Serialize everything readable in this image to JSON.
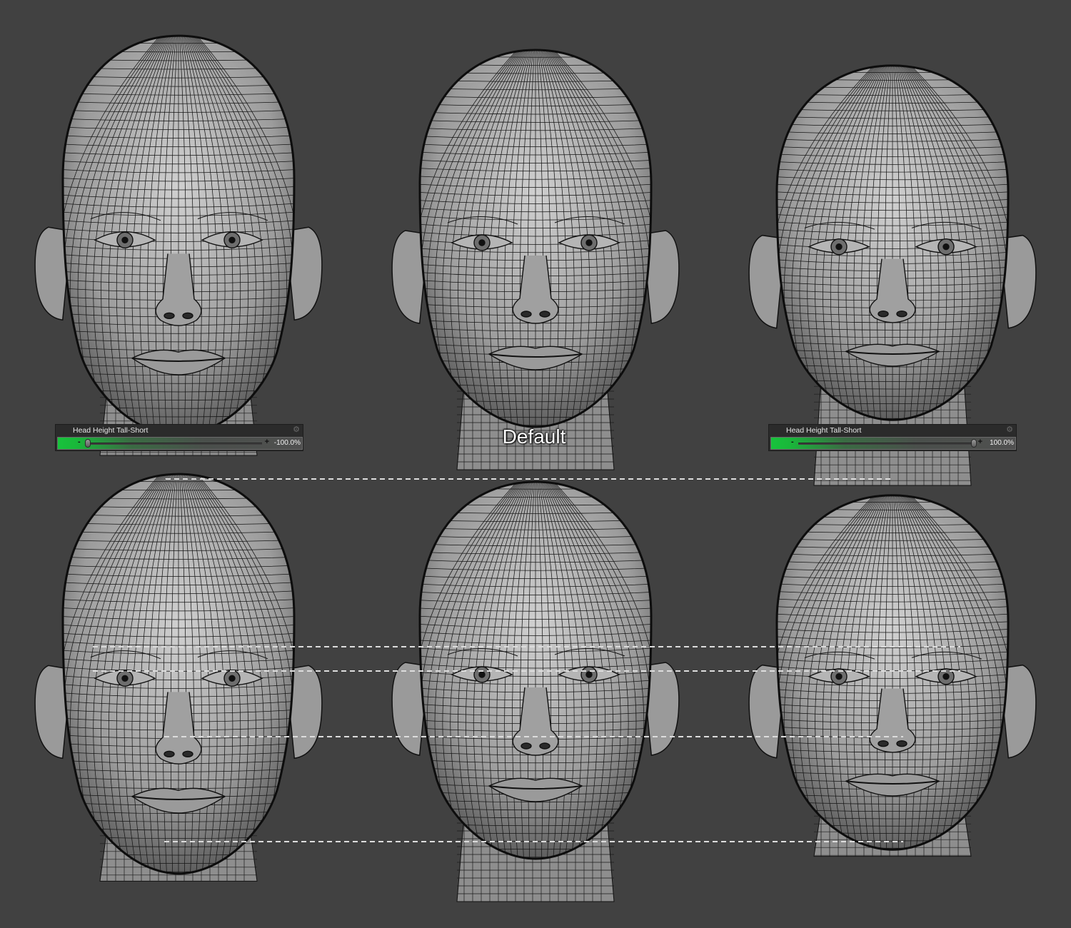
{
  "label_default": "Default",
  "sliders": {
    "left": {
      "title": "Head Height Tall-Short",
      "value_text": "-100.0%",
      "value": -100,
      "minus": "-",
      "plus": "+",
      "gear_icon": "gear-icon"
    },
    "right": {
      "title": "Head Height Tall-Short",
      "value_text": "100.0%",
      "value": 100,
      "minus": "-",
      "plus": "+",
      "gear_icon": "gear-icon"
    }
  },
  "colors": {
    "background": "#414141",
    "mesh_fill": "#a9a9a9",
    "wire": "#111111",
    "slider_green": "#18c23c",
    "guide": "#dddddd"
  }
}
